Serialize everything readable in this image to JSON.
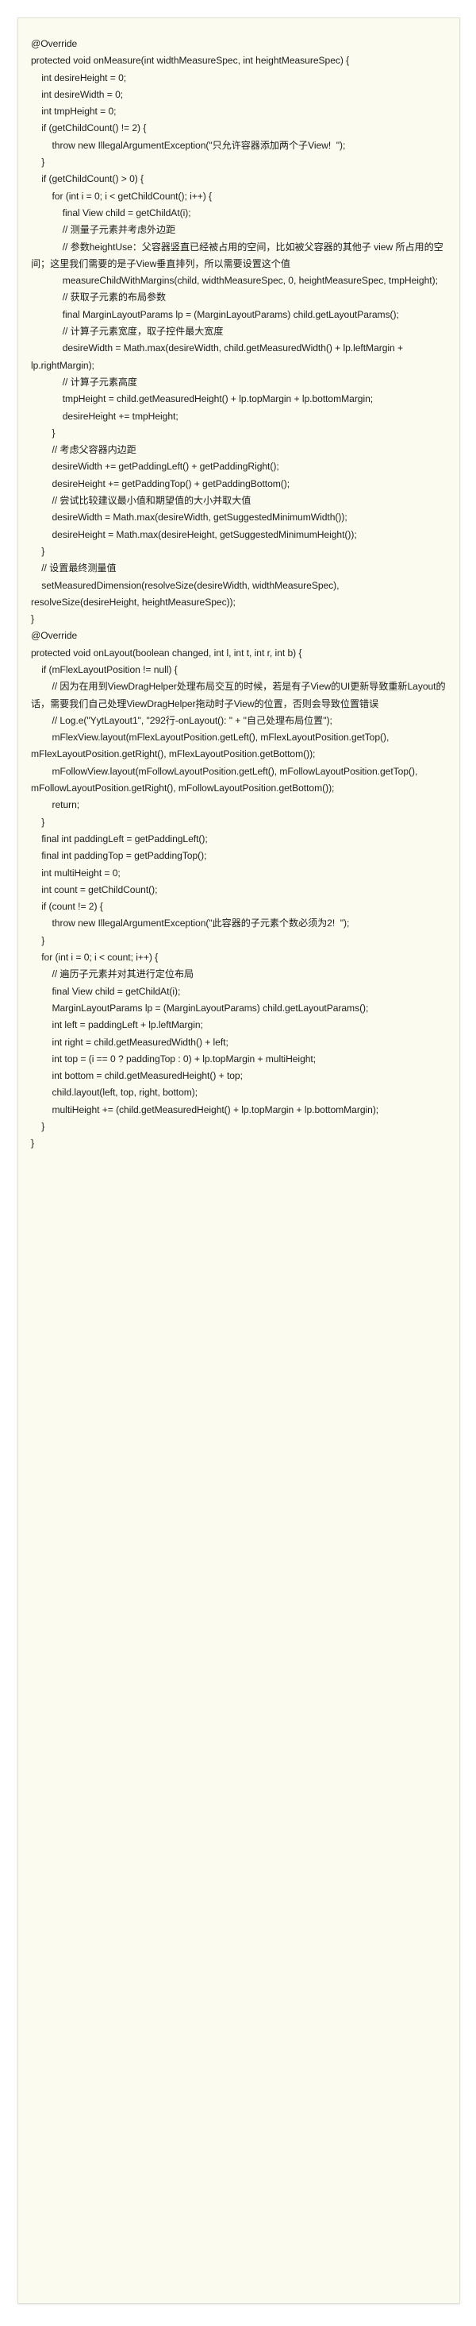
{
  "document": {
    "kind": "code-snippet",
    "language": "Java",
    "background_color": "#ffffff",
    "card_background_color": "#fbfbef",
    "card_border_color": "#dfdfd4",
    "text_color": "#1d1d1b"
  },
  "code": {
    "lines": [
      "@Override",
      "protected void onMeasure(int widthMeasureSpec, int heightMeasureSpec) {",
      "    int desireHeight = 0;",
      "    int desireWidth = 0;",
      "    int tmpHeight = 0;",
      "    if (getChildCount() != 2) {",
      "        throw new IllegalArgumentException(\"只允许容器添加两个子View!  \");",
      "    }",
      "    if (getChildCount() > 0) {",
      "        for (int i = 0; i < getChildCount(); i++) {",
      "            final View child = getChildAt(i);",
      "            // 测量子元素并考虑外边距",
      "            // 参数heightUse：父容器竖直已经被占用的空间，比如被父容器的其他子 view 所占用的空间；这里我们需要的是子View垂直排列，所以需要设置这个值",
      "            measureChildWithMargins(child, widthMeasureSpec, 0, heightMeasureSpec, tmpHeight);",
      "            // 获取子元素的布局参数",
      "            final MarginLayoutParams lp = (MarginLayoutParams) child.getLayoutParams();",
      "            // 计算子元素宽度，取子控件最大宽度",
      "            desireWidth = Math.max(desireWidth, child.getMeasuredWidth() + lp.leftMargin + lp.rightMargin);",
      "            // 计算子元素高度",
      "            tmpHeight = child.getMeasuredHeight() + lp.topMargin + lp.bottomMargin;",
      "            desireHeight += tmpHeight;",
      "        }",
      "        // 考虑父容器内边距",
      "        desireWidth += getPaddingLeft() + getPaddingRight();",
      "        desireHeight += getPaddingTop() + getPaddingBottom();",
      "        // 尝试比较建议最小值和期望值的大小并取大值",
      "        desireWidth = Math.max(desireWidth, getSuggestedMinimumWidth());",
      "        desireHeight = Math.max(desireHeight, getSuggestedMinimumHeight());",
      "    }",
      "    // 设置最终测量值",
      "    setMeasuredDimension(resolveSize(desireWidth, widthMeasureSpec), resolveSize(desireHeight, heightMeasureSpec));",
      "}",
      "@Override",
      "protected void onLayout(boolean changed, int l, int t, int r, int b) {",
      "    if (mFlexLayoutPosition != null) {",
      "        // 因为在用到ViewDragHelper处理布局交互的时候，若是有子View的UI更新导致重新Layout的话，需要我们自己处理ViewDragHelper拖动时子View的位置，否则会导致位置错误",
      "        // Log.e(\"YytLayout1\", \"292行-onLayout(): \" + \"自己处理布局位置\");",
      "        mFlexView.layout(mFlexLayoutPosition.getLeft(), mFlexLayoutPosition.getTop(), mFlexLayoutPosition.getRight(), mFlexLayoutPosition.getBottom());",
      "        mFollowView.layout(mFollowLayoutPosition.getLeft(), mFollowLayoutPosition.getTop(), mFollowLayoutPosition.getRight(), mFollowLayoutPosition.getBottom());",
      "        return;",
      "    }",
      "    final int paddingLeft = getPaddingLeft();",
      "    final int paddingTop = getPaddingTop();",
      "    int multiHeight = 0;",
      "    int count = getChildCount();",
      "    if (count != 2) {",
      "        throw new IllegalArgumentException(\"此容器的子元素个数必须为2!  \");",
      "    }",
      "    for (int i = 0; i < count; i++) {",
      "        // 遍历子元素并对其进行定位布局",
      "        final View child = getChildAt(i);",
      "        MarginLayoutParams lp = (MarginLayoutParams) child.getLayoutParams();",
      "        int left = paddingLeft + lp.leftMargin;",
      "        int right = child.getMeasuredWidth() + left;",
      "        int top = (i == 0 ? paddingTop : 0) + lp.topMargin + multiHeight;",
      "        int bottom = child.getMeasuredHeight() + top;",
      "        child.layout(left, top, right, bottom);",
      "        multiHeight += (child.getMeasuredHeight() + lp.topMargin + lp.bottomMargin);",
      "    }",
      "}"
    ]
  }
}
